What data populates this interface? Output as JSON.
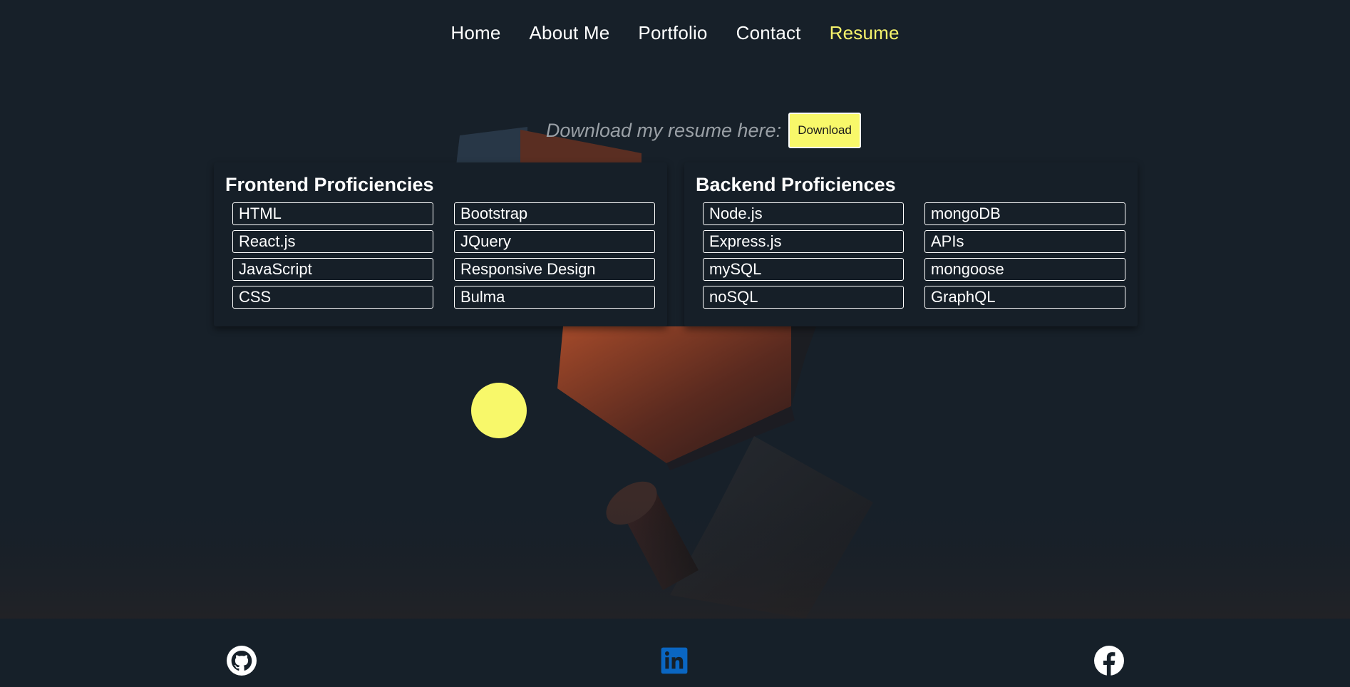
{
  "nav": {
    "items": [
      {
        "label": "Home"
      },
      {
        "label": "About Me"
      },
      {
        "label": "Portfolio"
      },
      {
        "label": "Contact"
      },
      {
        "label": "Resume"
      }
    ],
    "active_color": "#f6f36b"
  },
  "download": {
    "text": "Download my resume here:",
    "button_label": "Download",
    "button_color": "#f8f86a"
  },
  "frontend": {
    "title": "Frontend Proficiencies",
    "skills": [
      "HTML",
      "Bootstrap",
      "React.js",
      "JQuery",
      "JavaScript",
      "Responsive Design",
      "CSS",
      "Bulma"
    ]
  },
  "backend": {
    "title": "Backend Proficiences",
    "skills": [
      "Node.js",
      "mongoDB",
      "Express.js",
      "APIs",
      "mySQL",
      "mongoose",
      "noSQL",
      "GraphQL"
    ]
  },
  "footer": {
    "icons": [
      "github-icon",
      "linkedin-icon",
      "facebook-icon"
    ],
    "linkedin_color": "#0a66c2"
  },
  "colors": {
    "background": "#172029",
    "accent": "#f8f86a"
  }
}
